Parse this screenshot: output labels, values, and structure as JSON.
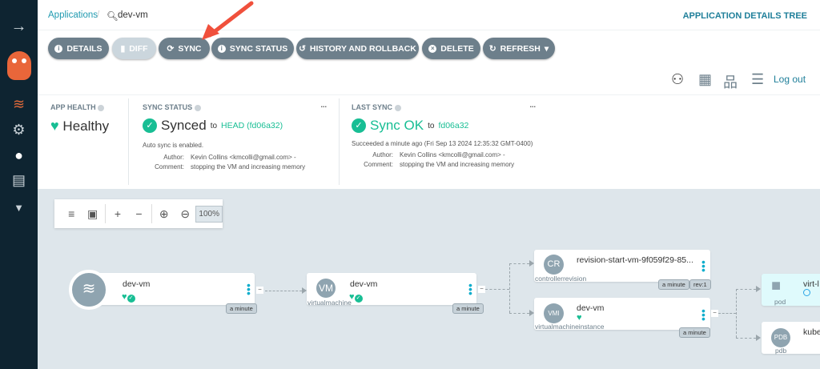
{
  "header": {
    "breadcrumb_root": "Applications",
    "app_name": "dev-vm",
    "page_title": "APPLICATION DETAILS TREE"
  },
  "sidebar": {
    "items": [
      "expand-arrow",
      "argo-logo",
      "applications",
      "settings",
      "user-info",
      "documentation",
      "filter"
    ]
  },
  "toolbar": {
    "buttons": [
      "DETAILS",
      "DIFF",
      "SYNC",
      "SYNC STATUS",
      "HISTORY AND ROLLBACK",
      "DELETE",
      "REFRESH"
    ],
    "logout": "Log out"
  },
  "status": {
    "app_health": {
      "label": "APP HEALTH",
      "value": "Healthy"
    },
    "sync_status": {
      "label": "SYNC STATUS",
      "value": "Synced",
      "to": "to",
      "target": "HEAD (fd06a32)",
      "auto": "Auto sync is enabled.",
      "author_label": "Author:",
      "author": "Kevin Collins <kmcolli@gmail.com> -",
      "comment_label": "Comment:",
      "comment": "stopping the VM and increasing memory",
      "more": "..."
    },
    "last_sync": {
      "label": "LAST SYNC",
      "value": "Sync OK",
      "to": "to",
      "target": "fd06a32",
      "time": "Succeeded a minute ago (Fri Sep 13 2024 12:35:32 GMT-0400)",
      "author_label": "Author:",
      "author": "Kevin Collins <kmcolli@gmail.com> -",
      "comment_label": "Comment:",
      "comment": "stopping the VM and increasing memory",
      "more": "..."
    }
  },
  "graph_toolbar": {
    "zoom": "100%"
  },
  "nodes": {
    "app": {
      "name": "dev-vm",
      "age": "a minute"
    },
    "vm": {
      "icon": "VM",
      "name": "dev-vm",
      "kind": "virtualmachine",
      "age": "a minute"
    },
    "cr": {
      "icon": "CR",
      "name": "revision-start-vm-9f059f29-85...",
      "kind": "controllerrevision",
      "age": "a minute",
      "rev": "rev:1"
    },
    "vmi": {
      "icon": "VMI",
      "name": "dev-vm",
      "kind": "virtualmachineinstance",
      "age": "a minute"
    },
    "pod": {
      "name": "virt-l",
      "kind": "pod"
    },
    "pdb": {
      "icon": "PDB",
      "name": "kube",
      "kind": "pdb"
    }
  },
  "colors": {
    "accent": "#18be94",
    "link": "#1f9ab0",
    "button": "#6d7f8b",
    "sidebar": "#0e2431",
    "annotation_arrow": "#f0503c"
  }
}
